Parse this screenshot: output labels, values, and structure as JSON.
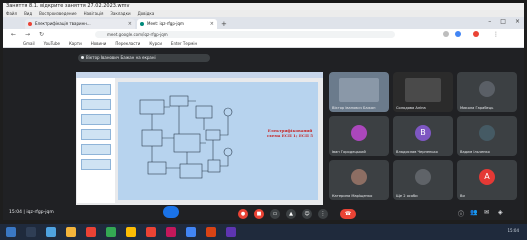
{
  "window": {
    "title": "Заняття 8.1. відкрите заняття 27.02.2023.wmv"
  },
  "menu": {
    "items": [
      "Файл",
      "Вид",
      "Воспроизведение",
      "Навігація",
      "Закладки",
      "Довідка"
    ]
  },
  "browser": {
    "tabs": [
      {
        "label": "Електрифікація тваринн...",
        "favicon_color": "#ea4335"
      },
      {
        "label": "Meet: iqz-rfgp-jqm",
        "favicon_color": "#00897b"
      }
    ],
    "url": "meet.google.com/iqz-rfgp-jqm",
    "bookmarks": [
      "Gmail",
      "YouTube",
      "Карти",
      "Новини",
      "Перекласти",
      "Курси",
      "Enter Термін"
    ]
  },
  "meet": {
    "banner": "Віктор Іванович Бажан на екрані",
    "slide_title": "Електрифікований схема ЕСП 1; ЕСП 5",
    "participants": [
      {
        "name": "Віктор Іванович Бажан",
        "avatar": "",
        "color": "#6b7b8c"
      },
      {
        "name": "Солодова Аліна",
        "avatar": "",
        "color": "#2b2b2b"
      },
      {
        "name": "Микола Гарабець",
        "avatar": "",
        "color": "#5a5f66"
      },
      {
        "name": "Іван Городецький",
        "avatar": "",
        "color": "#ab47bc"
      },
      {
        "name": "Владислав Черненько",
        "avatar": "B",
        "color": "#7e57c2"
      },
      {
        "name": "Вадим Ільченко",
        "avatar": "",
        "color": "#455a64"
      },
      {
        "name": "Катерина Маріщенко",
        "avatar": "",
        "color": "#8d6e63"
      },
      {
        "name": "Ще 2 особи",
        "avatar": "",
        "color": "#5f6368"
      },
      {
        "name": "Ви",
        "avatar": "A",
        "color": "#e53935"
      }
    ],
    "time": "15:04",
    "meeting_code": "iqz-rfgp-jqm"
  },
  "taskbar": {
    "clock": "15:04"
  }
}
